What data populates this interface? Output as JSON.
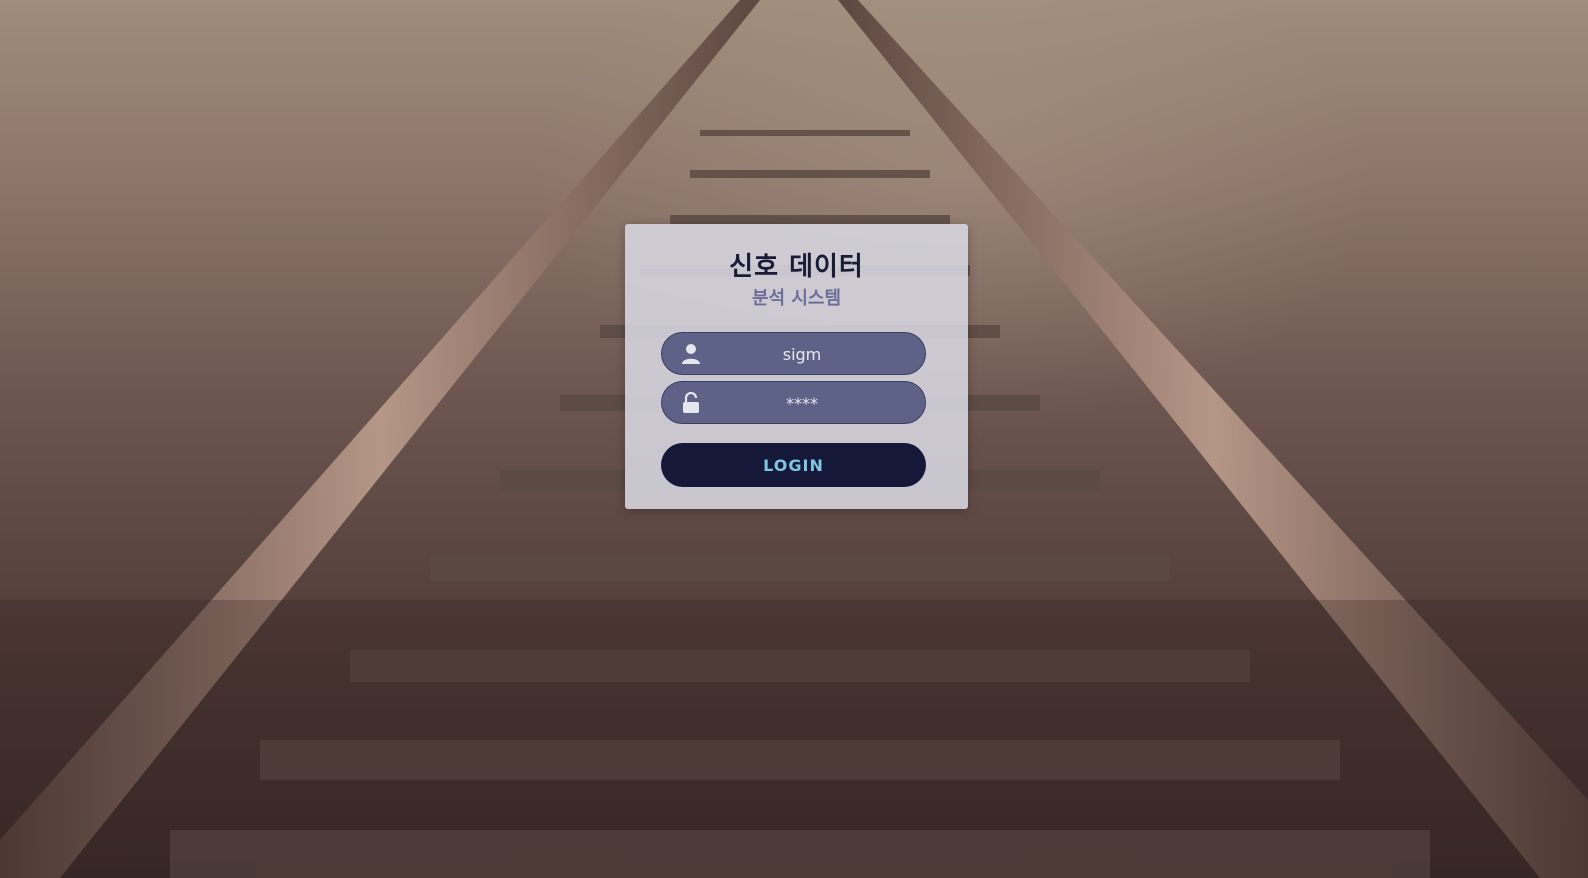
{
  "login": {
    "title": "신호 데이터",
    "subtitle": "분석 시스템",
    "username_value": "sigm",
    "password_value": "****",
    "login_label": "LOGIN"
  },
  "icons": {
    "user": "user-icon",
    "lock": "unlock-icon"
  },
  "colors": {
    "card_bg": "#d7d7e1",
    "field_bg": "#5f6287",
    "button_bg": "#16183a",
    "button_text": "#7fc7e0",
    "title": "#1a1c36",
    "subtitle": "#6d6f9a"
  }
}
